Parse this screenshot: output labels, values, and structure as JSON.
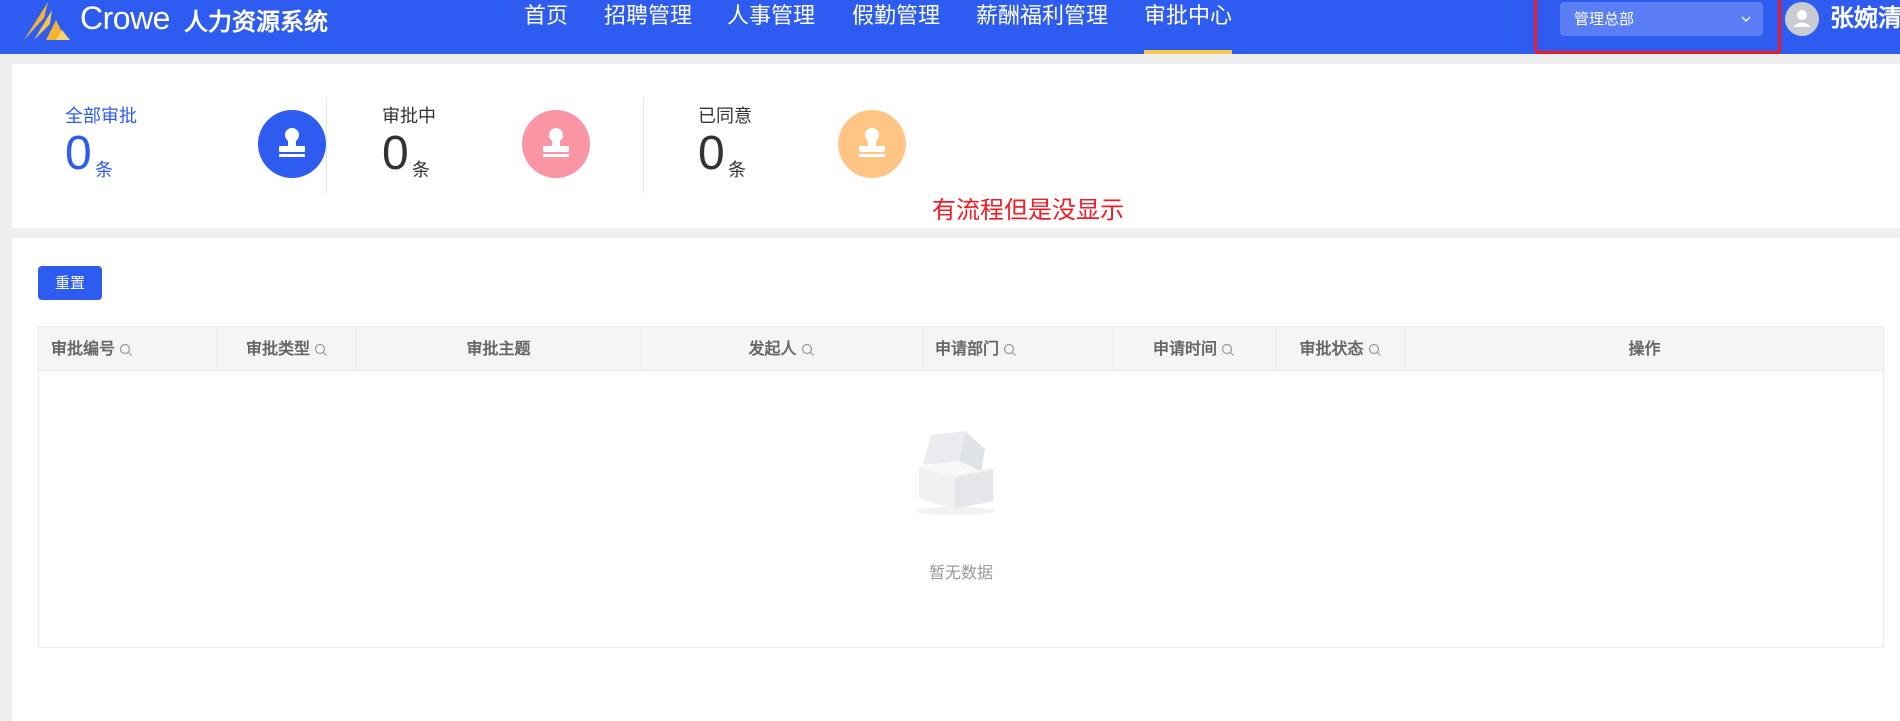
{
  "header": {
    "brand_word": "Crowe",
    "system_name": "人力资源系统",
    "nav": [
      "首页",
      "招聘管理",
      "人事管理",
      "假勤管理",
      "薪酬福利管理",
      "审批中心"
    ],
    "active_nav": "审批中心",
    "org_select": "管理总部",
    "user_name": "张婉清"
  },
  "stats": [
    {
      "label": "全部审批",
      "value": "0",
      "unit": "条",
      "color": "#2e5cf0"
    },
    {
      "label": "审批中",
      "value": "0",
      "unit": "条",
      "color": "#fa96a3"
    },
    {
      "label": "已同意",
      "value": "0",
      "unit": "条",
      "color": "#ffc585"
    }
  ],
  "annotation": "有流程但是没显示",
  "toolbar": {
    "reset_label": "重置"
  },
  "table": {
    "columns": [
      "审批编号",
      "审批类型",
      "审批主题",
      "发起人",
      "申请部门",
      "申请时间",
      "审批状态",
      "操作"
    ],
    "empty_text": "暂无数据"
  },
  "colors": {
    "primary": "#2e5cf0",
    "accent_underline": "#f5c74a",
    "highlight_red": "#ee1c25"
  }
}
